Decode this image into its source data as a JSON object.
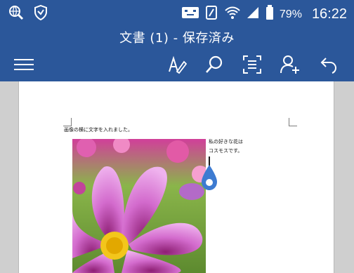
{
  "status_bar": {
    "battery": "79%",
    "time": "16:22",
    "icons": [
      "search-globe-icon",
      "shield-icon",
      "keyboard-icon",
      "nfc-icon",
      "wifi-icon",
      "signal-icon",
      "battery-icon"
    ]
  },
  "app_bar": {
    "title": "文書 (1) - 保存済み",
    "toolbar_icons": [
      "menu-icon",
      "pen-icon",
      "search-icon",
      "focus-icon",
      "add-user-icon",
      "undo-icon"
    ]
  },
  "document": {
    "line1": "画像の横に文字を入れました。",
    "caption_line1": "私の好きな花は",
    "caption_line2": "コスモスです。",
    "image": "pink-cosmos-flower-photo"
  },
  "colors": {
    "accent": "#2b579a",
    "cursor_handle": "#3d7bd1"
  }
}
